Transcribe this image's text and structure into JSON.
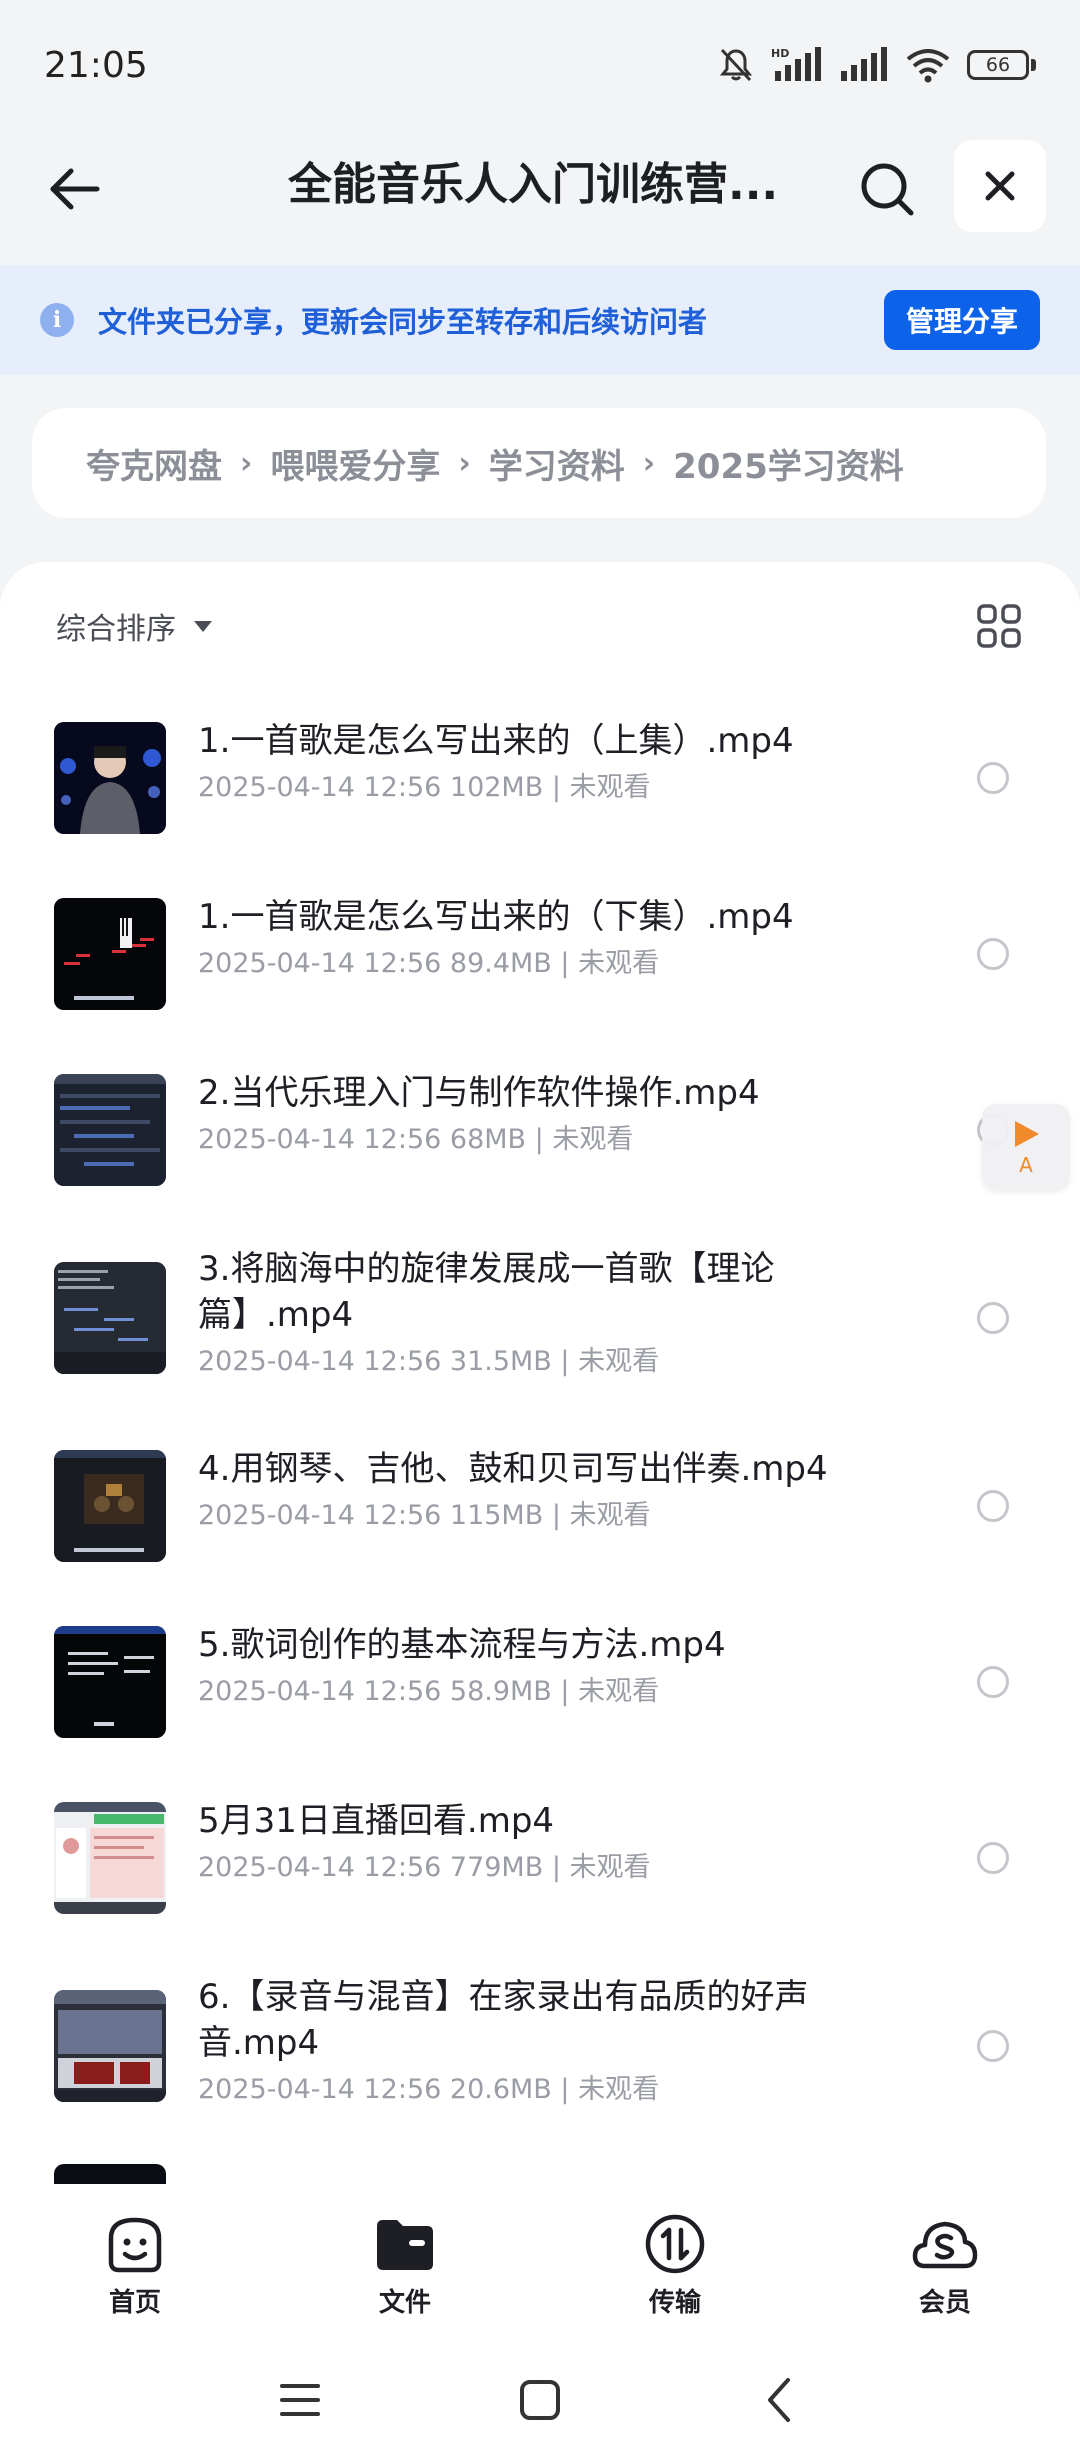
{
  "status_bar": {
    "time": "21:05",
    "network_label": "HD",
    "battery": "66",
    "icons": [
      "mute-icon",
      "signal-hd-icon",
      "signal-icon",
      "wifi-icon",
      "battery-icon"
    ]
  },
  "header": {
    "title": "全能音乐人入门训练营...",
    "icons": [
      "back-arrow-icon",
      "search-icon",
      "close-icon"
    ]
  },
  "share_banner": {
    "text": "文件夹已分享，更新会同步至转存和后续访问者",
    "button": "管理分享",
    "icon": "info-icon",
    "accent_color": "#0d62ea"
  },
  "breadcrumb": {
    "items": [
      "夸克网盘",
      "喂喂爱分享",
      "学习资料",
      "2025学习资料"
    ],
    "separator": "›"
  },
  "toolbar": {
    "sort_label": "综合排序",
    "view_toggle_icon": "grid-view-icon"
  },
  "files": [
    {
      "name": "1.一首歌是怎么写出来的（上集）.mp4",
      "date": "2025-04-14 12:56",
      "size": "102MB",
      "status": "未观看",
      "meta": "2025-04-14 12:56  102MB | 未观看"
    },
    {
      "name": "1.一首歌是怎么写出来的（下集）.mp4",
      "date": "2025-04-14 12:56",
      "size": "89.4MB",
      "status": "未观看",
      "meta": "2025-04-14 12:56  89.4MB | 未观看"
    },
    {
      "name": "2.当代乐理入门与制作软件操作.mp4",
      "date": "2025-04-14 12:56",
      "size": "68MB",
      "status": "未观看",
      "meta": "2025-04-14 12:56  68MB | 未观看"
    },
    {
      "name": "3.将脑海中的旋律发展成一首歌【理论篇】.mp4",
      "date": "2025-04-14 12:56",
      "size": "31.5MB",
      "status": "未观看",
      "meta": "2025-04-14 12:56  31.5MB | 未观看"
    },
    {
      "name": "4.用钢琴、吉他、鼓和贝司写出伴奏.mp4",
      "date": "2025-04-14 12:56",
      "size": "115MB",
      "status": "未观看",
      "meta": "2025-04-14 12:56  115MB | 未观看"
    },
    {
      "name": "5.歌词创作的基本流程与方法.mp4",
      "date": "2025-04-14 12:56",
      "size": "58.9MB",
      "status": "未观看",
      "meta": "2025-04-14 12:56  58.9MB | 未观看"
    },
    {
      "name": "5月31日直播回看.mp4",
      "date": "2025-04-14 12:56",
      "size": "779MB",
      "status": "未观看",
      "meta": "2025-04-14 12:56  779MB | 未观看"
    },
    {
      "name": "6.【录音与混音】在家录出有品质的好声音.mp4",
      "date": "2025-04-14 12:56",
      "size": "20.6MB",
      "status": "未观看",
      "meta": "2025-04-14 12:56  20.6MB | 未观看"
    }
  ],
  "float_button": {
    "label": "A",
    "icon": "play-icon",
    "color": "#f08a2a"
  },
  "bottom_nav": [
    {
      "label": "首页",
      "icon": "home-smile-icon"
    },
    {
      "label": "文件",
      "icon": "folder-icon"
    },
    {
      "label": "传输",
      "icon": "transfer-icon"
    },
    {
      "label": "会员",
      "icon": "vip-cloud-icon"
    }
  ],
  "system_nav": [
    "menu-icon",
    "home-square-icon",
    "back-chevron-icon"
  ]
}
